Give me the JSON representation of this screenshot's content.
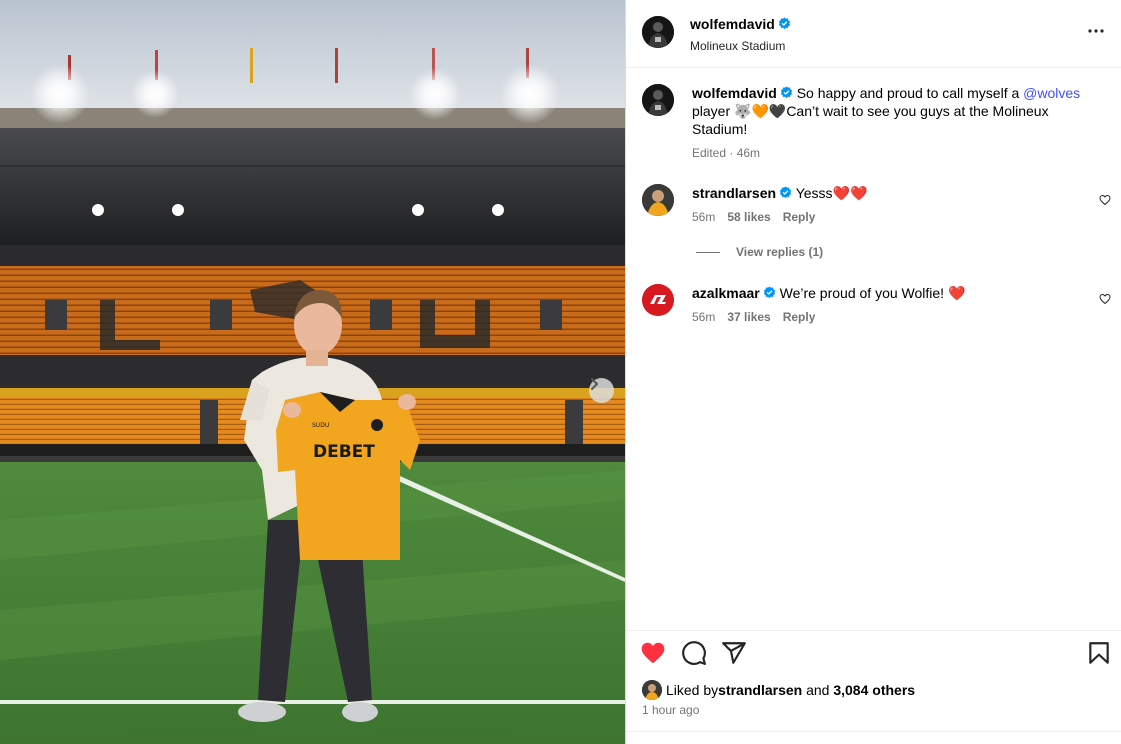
{
  "post": {
    "author": "wolfemdavid",
    "location": "Molineux Stadium",
    "caption": {
      "before_mention": "So happy and proud to call myself a ",
      "mention": "@wolves",
      "after_mention": " player 🐺🧡🖤Can’t wait to see you guys at the Molineux Stadium!"
    },
    "caption_meta": "Edited · 46m",
    "liked_by_prefix": "Liked by ",
    "liked_by_user": "strandlarsen",
    "liked_by_and": " and ",
    "liked_by_others": "3,084 others",
    "posted_ago": "1 hour ago"
  },
  "photo": {
    "jersey_text": "DEBET",
    "jersey_maker": "SUDU"
  },
  "comments": [
    {
      "user": "strandlarsen",
      "text": "Yesss❤️❤️",
      "age": "56m",
      "likes": "58 likes",
      "reply": "Reply"
    },
    {
      "user": "azalkmaar",
      "text": "We’re proud of you Wolfie! ❤️",
      "age": "56m",
      "likes": "37 likes",
      "reply": "Reply"
    }
  ],
  "view_replies": "View replies (1)",
  "colors": {
    "like_red": "#ff3040",
    "mention_blue": "#4150f7",
    "verified_blue": "#0095f6",
    "muted_text": "#737373",
    "az_red": "#d71920",
    "wolves_gold": "#f2a61f"
  },
  "icons": {
    "more": "more-options-icon",
    "like": "heart-filled-icon",
    "comment": "comment-icon",
    "share": "share-icon",
    "save": "bookmark-icon",
    "next": "chevron-right-icon",
    "verified": "verified-badge-icon"
  }
}
